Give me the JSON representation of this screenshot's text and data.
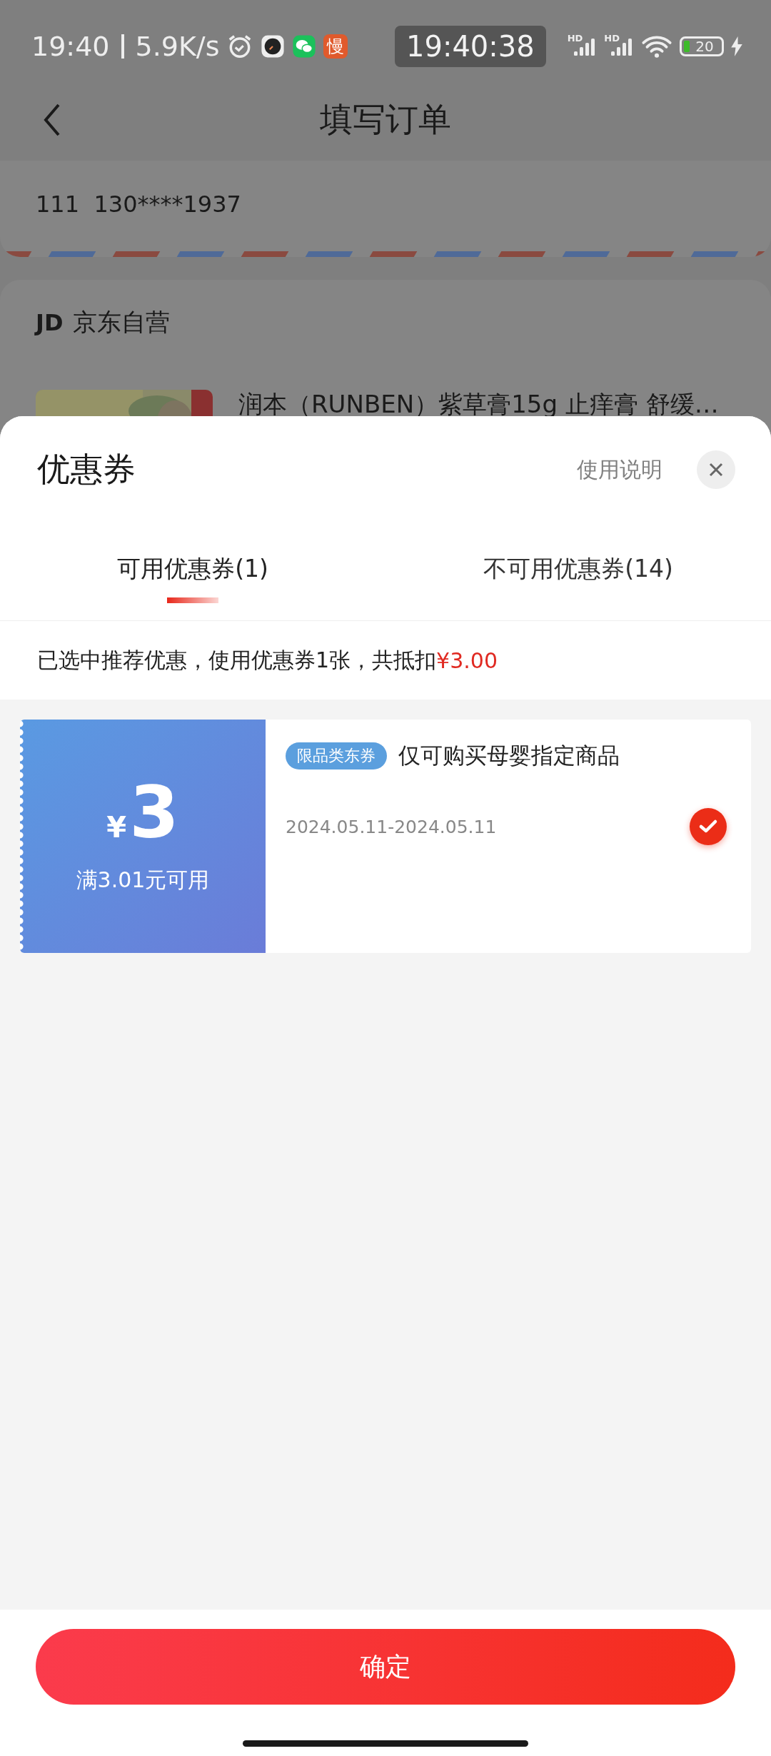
{
  "status_bar": {
    "time": "19:40",
    "network_speed": "5.9K/s",
    "app_badge": "慢",
    "clock": "19:40:38",
    "signal_labels": [
      "HD",
      "HD"
    ],
    "battery": "20",
    "charging": true
  },
  "header": {
    "title": "填写订单"
  },
  "address": {
    "name": "111",
    "phone": "130****1937"
  },
  "store": {
    "logo": "JD",
    "name": "京东自营",
    "product_title": "润本（RUNBEN）紫草膏15g 止痒膏 舒缓…"
  },
  "coupon_sheet": {
    "title": "优惠券",
    "help_link": "使用说明",
    "tabs": [
      {
        "label": "可用优惠券(1)",
        "selected": true
      },
      {
        "label": "不可用优惠券(14)",
        "selected": false
      }
    ],
    "summary": {
      "text": "已选中推荐优惠，使用优惠券1张，共抵扣",
      "amount": "¥3.00"
    },
    "coupons": [
      {
        "currency": "¥",
        "amount": "3",
        "condition": "满3.01元可用",
        "tag": "限品类东券",
        "description": "仅可购买母婴指定商品",
        "validity": "2024.05.11-2024.05.11",
        "selected": true
      }
    ]
  },
  "confirm_button": "确定"
}
